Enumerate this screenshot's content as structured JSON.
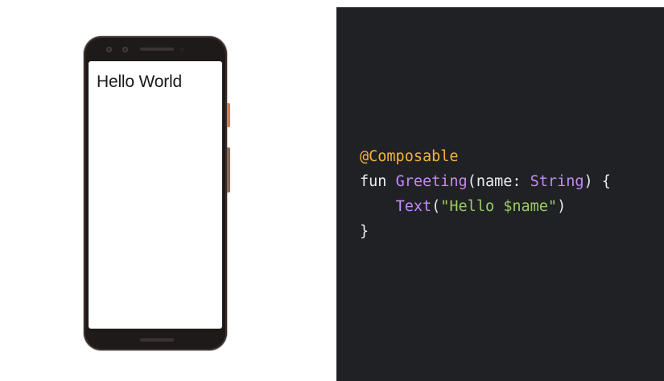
{
  "phone": {
    "screen_text": "Hello World"
  },
  "code": {
    "annotation": "@Composable",
    "keyword_fun": "fun",
    "function_name": "Greeting",
    "open_paren": "(",
    "param_name": "name",
    "colon": ": ",
    "param_type": "String",
    "close_sig": ") {",
    "indent": "    ",
    "call_name": "Text",
    "call_open": "(",
    "string_literal": "\"Hello $name\"",
    "call_close": ")",
    "closing_brace": "}"
  },
  "colors": {
    "code_background": "#202124",
    "annotation": "#f2b33d",
    "identifier": "#c58af9",
    "string": "#9ccc65",
    "plain": "#e8eaed"
  }
}
